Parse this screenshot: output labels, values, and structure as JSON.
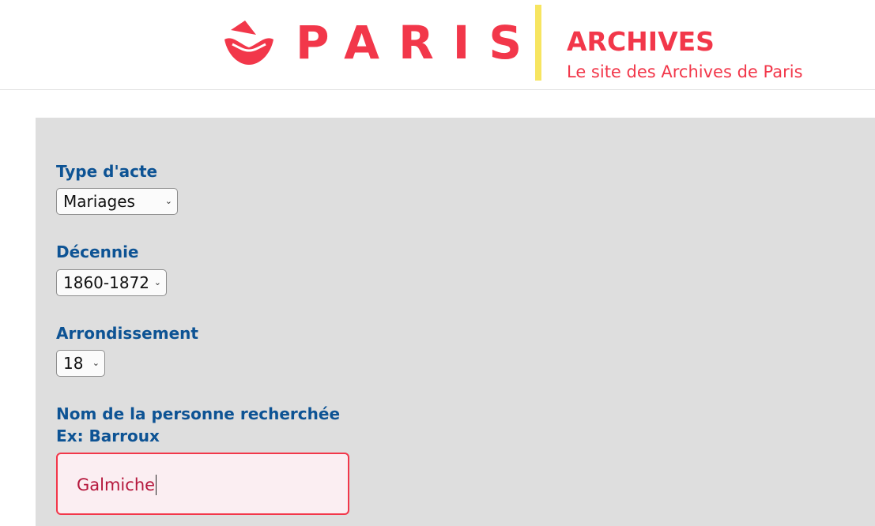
{
  "header": {
    "brand_word": "PARIS",
    "brand_icon": "paris-boat-logo-icon",
    "site_title": "ARCHIVES",
    "site_subtitle": "Le site des Archives de Paris",
    "colors": {
      "brand_red": "#f2374a",
      "divider_yellow": "#f7e560"
    }
  },
  "form": {
    "type_acte": {
      "label": "Type d'acte",
      "selected": "Mariages"
    },
    "decennie": {
      "label": "Décennie",
      "selected": "1860-1872"
    },
    "arrondissement": {
      "label": "Arrondissement",
      "selected": "18"
    },
    "nom": {
      "label": "Nom de la personne recherchée",
      "hint": "Ex: Barroux",
      "value": "Galmiche"
    },
    "colors": {
      "label_blue": "#0d5394",
      "panel_gray": "#dedede",
      "input_focus_border": "#f2374a",
      "input_text": "#b5173c"
    }
  }
}
